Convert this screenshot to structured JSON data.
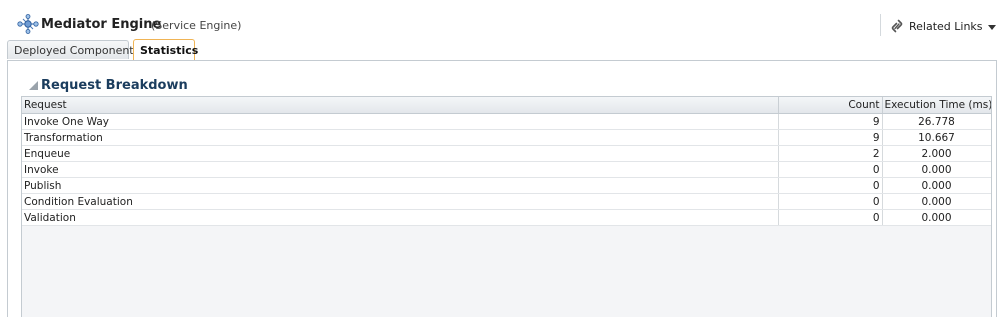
{
  "header": {
    "title": "Mediator Engine",
    "subtitle": "(Service Engine)",
    "related_links": "Related Links"
  },
  "tabs": [
    {
      "label": "Deployed Components",
      "selected": false
    },
    {
      "label": "Statistics",
      "selected": true
    }
  ],
  "section": {
    "title": "Request Breakdown"
  },
  "table": {
    "columns": [
      "Request",
      "Count",
      "Execution Time (ms)"
    ],
    "rows": [
      {
        "request": "Invoke One Way",
        "count": "9",
        "time": "26.778"
      },
      {
        "request": "Transformation",
        "count": "9",
        "time": "10.667"
      },
      {
        "request": "Enqueue",
        "count": "2",
        "time": "2.000"
      },
      {
        "request": "Invoke",
        "count": "0",
        "time": "0.000"
      },
      {
        "request": "Publish",
        "count": "0",
        "time": "0.000"
      },
      {
        "request": "Condition Evaluation",
        "count": "0",
        "time": "0.000"
      },
      {
        "request": "Validation",
        "count": "0",
        "time": "0.000"
      }
    ]
  },
  "colors": {
    "accent_tab_border": "#f0b455",
    "section_title": "#1b3d5e"
  }
}
